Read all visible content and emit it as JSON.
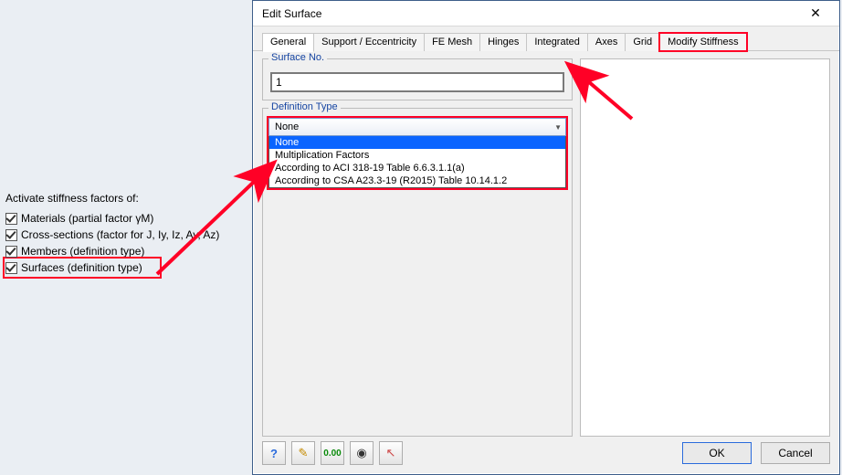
{
  "left": {
    "title": "Activate stiffness factors of:",
    "items": [
      "Materials (partial factor γM)",
      "Cross-sections (factor for J, Iy, Iz, Ay, Az)",
      "Members (definition type)",
      "Surfaces (definition type)"
    ]
  },
  "dialog": {
    "title": "Edit Surface",
    "tabs": [
      "General",
      "Support / Eccentricity",
      "FE Mesh",
      "Hinges",
      "Integrated",
      "Axes",
      "Grid",
      "Modify Stiffness"
    ],
    "active_tab": "Modify Stiffness",
    "surface_no_label": "Surface No.",
    "surface_no_value": "1",
    "definition_label": "Definition Type",
    "combo_value": "None",
    "dropdown": [
      "None",
      "Multiplication Factors",
      "According to ACI 318-19 Table 6.6.3.1.1(a)",
      "According to CSA A23.3-19 (R2015) Table 10.14.1.2"
    ],
    "ok": "OK",
    "cancel": "Cancel"
  }
}
